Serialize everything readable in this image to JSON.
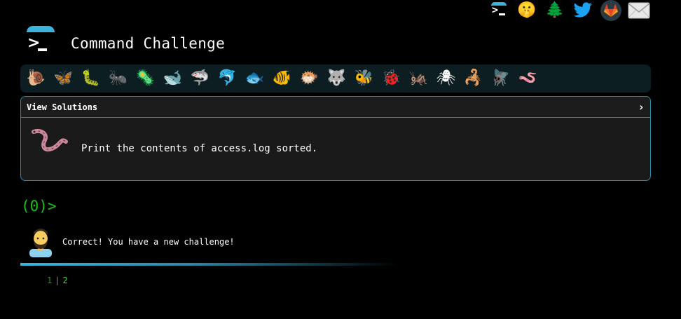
{
  "header": {
    "title": "Command Challenge",
    "social_icons": [
      {
        "name": "terminal-icon",
        "glyph": ""
      },
      {
        "name": "shushing-face-icon",
        "glyph": "🤫"
      },
      {
        "name": "tree-icon",
        "glyph": "🌲"
      },
      {
        "name": "twitter-icon",
        "glyph": "🐦"
      },
      {
        "name": "gitlab-icon",
        "glyph": "🦊"
      },
      {
        "name": "mail-icon",
        "glyph": "✉"
      }
    ]
  },
  "animals": [
    {
      "name": "snail-icon",
      "glyph": "🐌"
    },
    {
      "name": "butterfly-icon",
      "glyph": "🦋"
    },
    {
      "name": "caterpillar-icon",
      "glyph": "🐛"
    },
    {
      "name": "ant-icon",
      "glyph": "🐜"
    },
    {
      "name": "microbe-icon",
      "glyph": "🦠"
    },
    {
      "name": "whale-icon",
      "glyph": "🐋"
    },
    {
      "name": "shark-icon",
      "glyph": "🦈"
    },
    {
      "name": "dolphin-icon",
      "glyph": "🐬"
    },
    {
      "name": "fish-icon",
      "glyph": "🐟"
    },
    {
      "name": "tropical-fish-icon",
      "glyph": "🐠"
    },
    {
      "name": "blowfish-icon",
      "glyph": "🐡"
    },
    {
      "name": "wolf-icon",
      "glyph": "🐺"
    },
    {
      "name": "bee-icon",
      "glyph": "🐝"
    },
    {
      "name": "ladybug-icon",
      "glyph": "🐞"
    },
    {
      "name": "cricket-icon",
      "glyph": "🦗"
    },
    {
      "name": "spider-icon",
      "glyph": "🕷"
    },
    {
      "name": "scorpion-icon",
      "glyph": "🦂"
    },
    {
      "name": "fly-icon",
      "glyph": "🪰"
    },
    {
      "name": "worm-icon",
      "glyph": "🪱"
    }
  ],
  "panel": {
    "header_label": "View Solutions",
    "toggle_glyph": "›",
    "challenge_text": "Print the contents of access.log sorted."
  },
  "prompt": {
    "text": "(0)>"
  },
  "feedback": {
    "message": "Correct! You have a new challenge!"
  },
  "pager": {
    "page1": "1",
    "separator": "|",
    "page2": "2"
  },
  "colors": {
    "accent": "#3bb4dd",
    "border": "#2b87a6",
    "prompt_green": "#19c019",
    "panel_bg": "#1a1a1a",
    "animal_bar_bg": "#0d1e22"
  }
}
